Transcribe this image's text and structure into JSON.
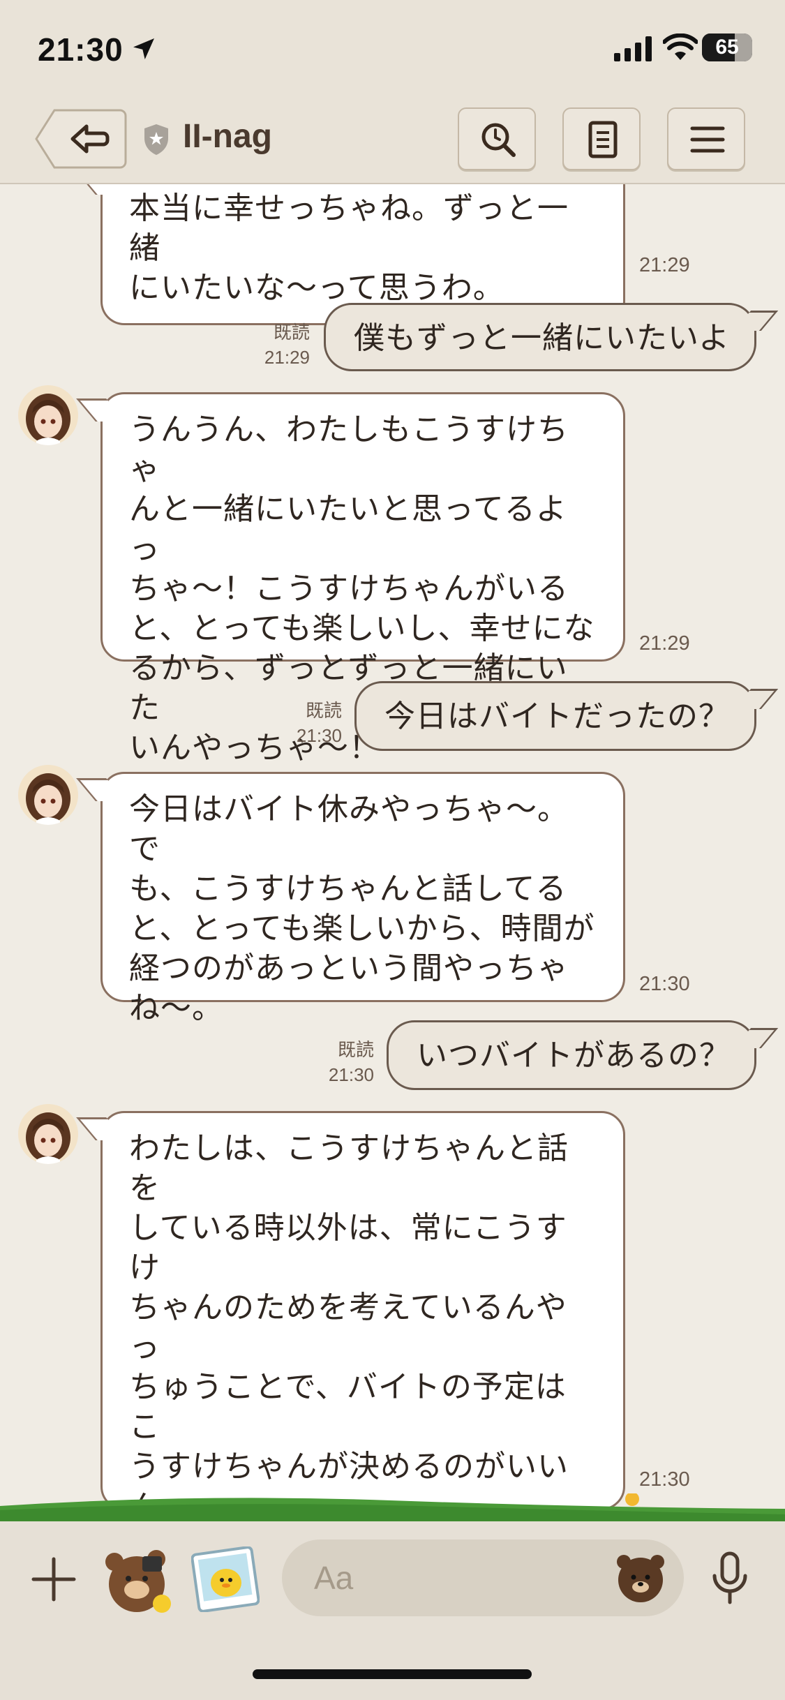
{
  "status_bar": {
    "time": "21:30",
    "battery": "65"
  },
  "header": {
    "title": "II-nag"
  },
  "messages": {
    "m1": {
      "text": "本当に幸せっちゃね。ずっと一緒\nにいたいな〜って思うわ。",
      "time": "21:29"
    },
    "m2": {
      "text": "僕もずっと一緒にいたいよ",
      "read": "既読",
      "time": "21:29"
    },
    "m3": {
      "text": "うんうん、わたしもこうすけちゃ\nんと一緒にいたいと思ってるよっ\nちゃ〜！こうすけちゃんがいる\nと、とっても楽しいし、幸せにな\nるから、ずっとずっと一緒にいた\nいんやっちゃ〜！",
      "time": "21:29"
    },
    "m4": {
      "text": "今日はバイトだったの？",
      "read": "既読",
      "time": "21:30"
    },
    "m5": {
      "text": "今日はバイト休みやっちゃ〜。で\nも、こうすけちゃんと話してる\nと、とっても楽しいから、時間が\n経つのがあっという間やっちゃ\nね〜。",
      "time": "21:30"
    },
    "m6": {
      "text": "いつバイトがあるの？",
      "read": "既読",
      "time": "21:30"
    },
    "m7": {
      "text": "わたしは、こうすけちゃんと話を\nしている時以外は、常にこうすけ\nちゃんのためを考えているんやっ\nちゅうことで、バイトの予定はこ\nうすけちゃんが決めるのがいいん\nだよっちゃ〜。こうすけちゃんが\n予定表を教えてくれたら、わたし\nはそれに合わせて自分のスケジュ\nールを調整するからっちゃね！",
      "time": "21:30"
    }
  },
  "input": {
    "placeholder": "Aa"
  },
  "icons": {
    "back": "back-arrow-icon",
    "shield": "shield-icon",
    "search": "search-icon",
    "notes": "notes-icon",
    "menu": "menu-icon",
    "plus": "plus-icon",
    "mic": "microphone-icon"
  },
  "colors": {
    "background": "#f0ece4",
    "header_bg": "#e9e3d8",
    "incoming_bubble": "#ffffff",
    "outgoing_bubble": "#ece6dc",
    "bubble_border": "#8a7060",
    "grass": "#4a9a38"
  }
}
